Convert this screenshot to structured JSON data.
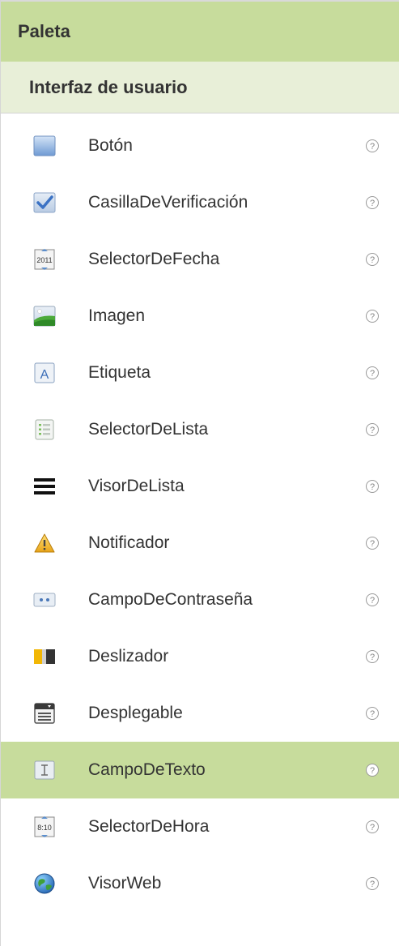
{
  "palette": {
    "title": "Paleta"
  },
  "category": {
    "title": "Interfaz de usuario"
  },
  "components": [
    {
      "label": "Botón",
      "icon": "button-icon"
    },
    {
      "label": "CasillaDeVerificación",
      "icon": "checkbox-icon"
    },
    {
      "label": "SelectorDeFecha",
      "icon": "date-picker-icon"
    },
    {
      "label": "Imagen",
      "icon": "image-icon"
    },
    {
      "label": "Etiqueta",
      "icon": "label-icon"
    },
    {
      "label": "SelectorDeLista",
      "icon": "list-picker-icon"
    },
    {
      "label": "VisorDeLista",
      "icon": "list-view-icon"
    },
    {
      "label": "Notificador",
      "icon": "notifier-icon"
    },
    {
      "label": "CampoDeContraseña",
      "icon": "password-field-icon"
    },
    {
      "label": "Deslizador",
      "icon": "slider-icon"
    },
    {
      "label": "Desplegable",
      "icon": "spinner-icon"
    },
    {
      "label": "CampoDeTexto",
      "icon": "text-field-icon",
      "selected": true
    },
    {
      "label": "SelectorDeHora",
      "icon": "time-picker-icon"
    },
    {
      "label": "VisorWeb",
      "icon": "web-viewer-icon"
    }
  ],
  "colors": {
    "header_bg": "#c7dc9c",
    "category_bg": "#e8efd8",
    "selected_bg": "#c7dc9c"
  }
}
